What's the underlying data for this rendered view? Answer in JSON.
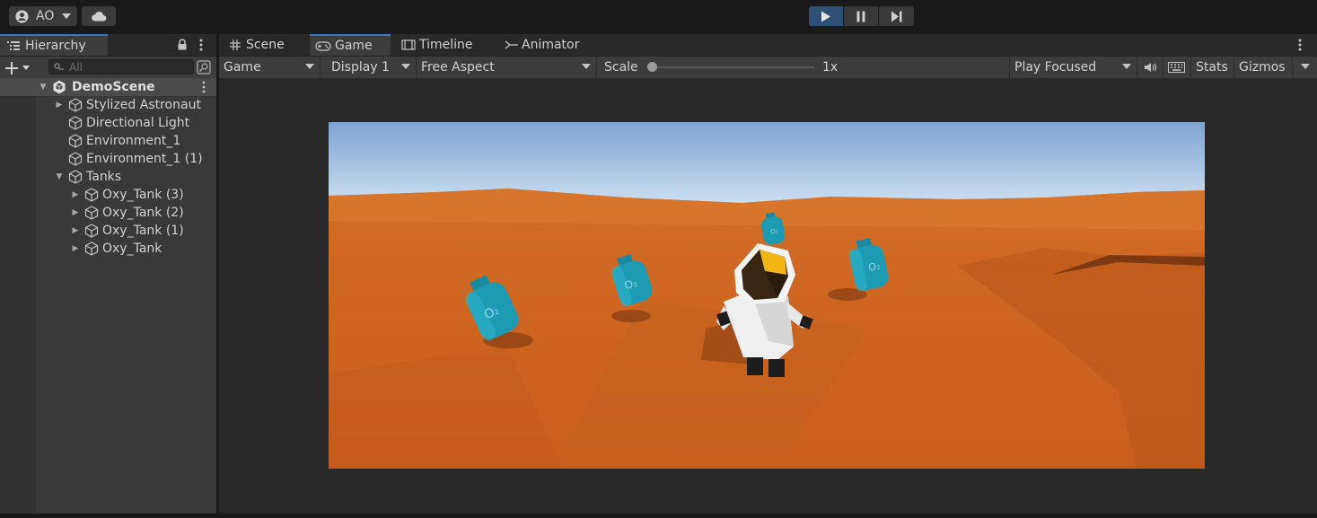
{
  "toolbar": {
    "account_label": "AO",
    "account_icon": "user-circle-icon",
    "cloud_icon": "cloud-icon",
    "play_icon": "play-icon",
    "pause_icon": "pause-icon",
    "step_icon": "step-icon"
  },
  "hierarchy": {
    "tab_label": "Hierarchy",
    "search_placeholder": "All",
    "scene_name": "DemoScene",
    "items": [
      {
        "label": "Stylized Astronaut",
        "depth": 1,
        "expandable": true
      },
      {
        "label": "Directional Light",
        "depth": 1,
        "expandable": false
      },
      {
        "label": "Environment_1",
        "depth": 1,
        "expandable": false
      },
      {
        "label": "Environment_1 (1)",
        "depth": 1,
        "expandable": false
      },
      {
        "label": "Tanks",
        "depth": 1,
        "expandable": true,
        "expanded": true
      },
      {
        "label": "Oxy_Tank (3)",
        "depth": 2,
        "expandable": true
      },
      {
        "label": "Oxy_Tank (2)",
        "depth": 2,
        "expandable": true
      },
      {
        "label": "Oxy_Tank (1)",
        "depth": 2,
        "expandable": true
      },
      {
        "label": "Oxy_Tank",
        "depth": 2,
        "expandable": true
      }
    ]
  },
  "game_panel": {
    "tabs": [
      {
        "label": "Scene",
        "icon": "grid-icon"
      },
      {
        "label": "Game",
        "icon": "gamepad-icon",
        "active": true
      },
      {
        "label": "Timeline",
        "icon": "film-icon"
      },
      {
        "label": "Animator",
        "icon": "animator-icon"
      }
    ],
    "controls": {
      "view_mode": "Game",
      "display": "Display 1",
      "aspect": "Free Aspect",
      "scale_label": "Scale",
      "scale_value": "1x",
      "play_mode": "Play Focused",
      "stats_label": "Stats",
      "gizmos_label": "Gizmos"
    },
    "tank_label": "O₂"
  },
  "colors": {
    "accent": "#3a79bb",
    "sky_top": "#7fa6d6",
    "sand": "#d86a22",
    "tank": "#1e9bb3"
  }
}
